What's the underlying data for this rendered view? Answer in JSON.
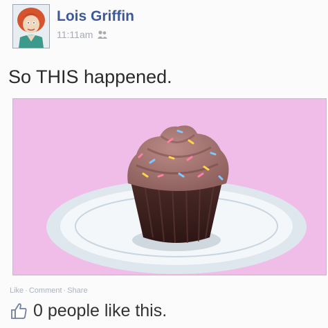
{
  "post": {
    "author": "Lois Griffin",
    "timestamp": "11:11am",
    "audience_icon": "friends-icon",
    "status_text": "So THIS happened.",
    "photo_subject": "cupcake-photo"
  },
  "actions": {
    "like_label": "Like",
    "separator": "·",
    "comment_label": "Comment",
    "share_label": "Share"
  },
  "likes": {
    "icon": "thumbs-up-icon",
    "text": "0 people like this."
  },
  "colors": {
    "author_name": "#3b5998",
    "photo_background": "#efbde8",
    "muted_text": "#a6aab2"
  }
}
